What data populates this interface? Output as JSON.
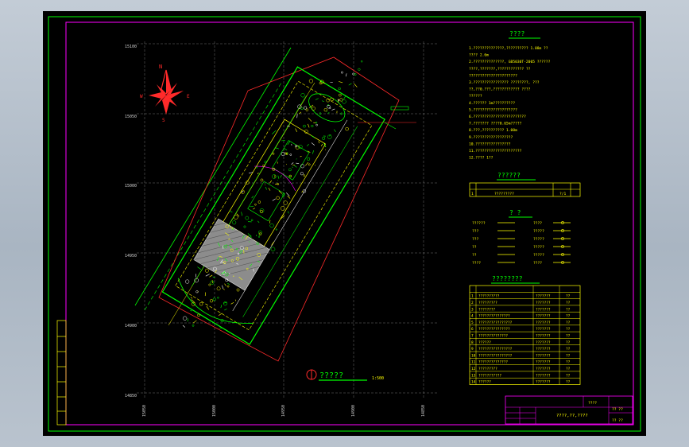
{
  "app": {
    "name": "CAD drawing viewer",
    "canvas_bg": "#000000",
    "window_bg": "#b4bfca"
  },
  "drawing": {
    "colors": {
      "outer_frame": "#00ff00",
      "inner_frame": "#ff00ff",
      "grid": "#8a8a8a",
      "notes": "#ffff00",
      "title": "#00ff00",
      "table_border": "#ffff00",
      "compass": "#ff2a2a"
    },
    "grid_labels_y": [
      "15100",
      "15050",
      "15000",
      "14950",
      "14900",
      "14850"
    ],
    "grid_labels_x": [
      "15050",
      "15000",
      "14950",
      "14900",
      "14850"
    ],
    "compass": {
      "n": "N",
      "s": "S",
      "e": "E",
      "w": "W"
    },
    "plan_title": "?????",
    "plan_scale": "1:500",
    "notes": {
      "title": "????",
      "lines": [
        "1.??????????????,??????????   1.08m  ??",
        "  ????  2.6m",
        "2.??????????????,  GB5030T-2005   ??????",
        "  ????,???????,????????????    ??",
        "  ??????????????????????",
        "3.????????????????   ????????,   ???",
        "  ??,??0.???,????????????    ????",
        "  ??????",
        "4.??????  1m??????????",
        "5.????????????????????",
        "6.????????????????????????",
        "7.???????   ????0.65m?????",
        "8.???,??????????  1.00m",
        "9.??????????????????",
        "10.????????????????",
        "11.?????????????????????",
        "12.????  1??"
      ]
    },
    "index_table": {
      "title": "??????",
      "rows": [
        {
          "no": "1",
          "name": "?????????",
          "sheet": "?/1"
        }
      ]
    },
    "legend": {
      "title": "?  ?",
      "left": [
        "??????",
        "???",
        "???",
        "??",
        "??",
        "????"
      ],
      "right": [
        "????",
        "?????",
        "?????",
        "?????",
        "?????",
        "????"
      ]
    },
    "material_table": {
      "title": "????????",
      "rows": [
        {
          "no": "1",
          "name": "??????????",
          "spec": "???????",
          "qty": "??"
        },
        {
          "no": "2",
          "name": "?????????",
          "spec": "???????",
          "qty": "??"
        },
        {
          "no": "3",
          "name": "????????",
          "spec": "???????",
          "qty": "??"
        },
        {
          "no": "4",
          "name": "???????????????",
          "spec": "???????",
          "qty": "??"
        },
        {
          "no": "5",
          "name": "????????????????",
          "spec": "???????",
          "qty": "??"
        },
        {
          "no": "6",
          "name": "???????????????",
          "spec": "???????",
          "qty": "??"
        },
        {
          "no": "7",
          "name": "??????????????",
          "spec": "???????",
          "qty": "??"
        },
        {
          "no": "8",
          "name": "??????",
          "spec": "???????",
          "qty": "??"
        },
        {
          "no": "9",
          "name": "????????????????",
          "spec": "???????",
          "qty": "??"
        },
        {
          "no": "10",
          "name": "????????????????",
          "spec": "???????",
          "qty": "??"
        },
        {
          "no": "11",
          "name": "??????????????",
          "spec": "???????",
          "qty": "??"
        },
        {
          "no": "12",
          "name": "?????????",
          "spec": "???????",
          "qty": "??"
        },
        {
          "no": "13",
          "name": "???????????",
          "spec": "???????",
          "qty": "??"
        },
        {
          "no": "14",
          "name": "??????",
          "spec": "???????",
          "qty": "??"
        }
      ]
    },
    "title_block": {
      "project": "????",
      "drawing_name": "????,??,????",
      "code": "??  ??",
      "scale": "?? ??"
    }
  }
}
